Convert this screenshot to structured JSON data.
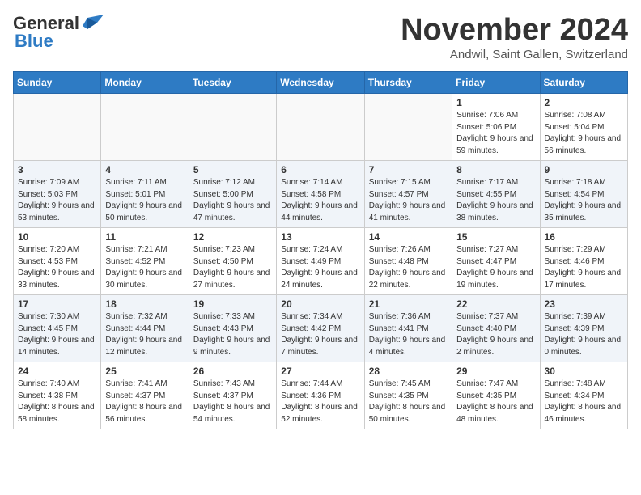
{
  "header": {
    "logo_general": "General",
    "logo_blue": "Blue",
    "month_year": "November 2024",
    "location": "Andwil, Saint Gallen, Switzerland"
  },
  "days_of_week": [
    "Sunday",
    "Monday",
    "Tuesday",
    "Wednesday",
    "Thursday",
    "Friday",
    "Saturday"
  ],
  "weeks": [
    [
      {
        "day": "",
        "info": ""
      },
      {
        "day": "",
        "info": ""
      },
      {
        "day": "",
        "info": ""
      },
      {
        "day": "",
        "info": ""
      },
      {
        "day": "",
        "info": ""
      },
      {
        "day": "1",
        "info": "Sunrise: 7:06 AM\nSunset: 5:06 PM\nDaylight: 9 hours and 59 minutes."
      },
      {
        "day": "2",
        "info": "Sunrise: 7:08 AM\nSunset: 5:04 PM\nDaylight: 9 hours and 56 minutes."
      }
    ],
    [
      {
        "day": "3",
        "info": "Sunrise: 7:09 AM\nSunset: 5:03 PM\nDaylight: 9 hours and 53 minutes."
      },
      {
        "day": "4",
        "info": "Sunrise: 7:11 AM\nSunset: 5:01 PM\nDaylight: 9 hours and 50 minutes."
      },
      {
        "day": "5",
        "info": "Sunrise: 7:12 AM\nSunset: 5:00 PM\nDaylight: 9 hours and 47 minutes."
      },
      {
        "day": "6",
        "info": "Sunrise: 7:14 AM\nSunset: 4:58 PM\nDaylight: 9 hours and 44 minutes."
      },
      {
        "day": "7",
        "info": "Sunrise: 7:15 AM\nSunset: 4:57 PM\nDaylight: 9 hours and 41 minutes."
      },
      {
        "day": "8",
        "info": "Sunrise: 7:17 AM\nSunset: 4:55 PM\nDaylight: 9 hours and 38 minutes."
      },
      {
        "day": "9",
        "info": "Sunrise: 7:18 AM\nSunset: 4:54 PM\nDaylight: 9 hours and 35 minutes."
      }
    ],
    [
      {
        "day": "10",
        "info": "Sunrise: 7:20 AM\nSunset: 4:53 PM\nDaylight: 9 hours and 33 minutes."
      },
      {
        "day": "11",
        "info": "Sunrise: 7:21 AM\nSunset: 4:52 PM\nDaylight: 9 hours and 30 minutes."
      },
      {
        "day": "12",
        "info": "Sunrise: 7:23 AM\nSunset: 4:50 PM\nDaylight: 9 hours and 27 minutes."
      },
      {
        "day": "13",
        "info": "Sunrise: 7:24 AM\nSunset: 4:49 PM\nDaylight: 9 hours and 24 minutes."
      },
      {
        "day": "14",
        "info": "Sunrise: 7:26 AM\nSunset: 4:48 PM\nDaylight: 9 hours and 22 minutes."
      },
      {
        "day": "15",
        "info": "Sunrise: 7:27 AM\nSunset: 4:47 PM\nDaylight: 9 hours and 19 minutes."
      },
      {
        "day": "16",
        "info": "Sunrise: 7:29 AM\nSunset: 4:46 PM\nDaylight: 9 hours and 17 minutes."
      }
    ],
    [
      {
        "day": "17",
        "info": "Sunrise: 7:30 AM\nSunset: 4:45 PM\nDaylight: 9 hours and 14 minutes."
      },
      {
        "day": "18",
        "info": "Sunrise: 7:32 AM\nSunset: 4:44 PM\nDaylight: 9 hours and 12 minutes."
      },
      {
        "day": "19",
        "info": "Sunrise: 7:33 AM\nSunset: 4:43 PM\nDaylight: 9 hours and 9 minutes."
      },
      {
        "day": "20",
        "info": "Sunrise: 7:34 AM\nSunset: 4:42 PM\nDaylight: 9 hours and 7 minutes."
      },
      {
        "day": "21",
        "info": "Sunrise: 7:36 AM\nSunset: 4:41 PM\nDaylight: 9 hours and 4 minutes."
      },
      {
        "day": "22",
        "info": "Sunrise: 7:37 AM\nSunset: 4:40 PM\nDaylight: 9 hours and 2 minutes."
      },
      {
        "day": "23",
        "info": "Sunrise: 7:39 AM\nSunset: 4:39 PM\nDaylight: 9 hours and 0 minutes."
      }
    ],
    [
      {
        "day": "24",
        "info": "Sunrise: 7:40 AM\nSunset: 4:38 PM\nDaylight: 8 hours and 58 minutes."
      },
      {
        "day": "25",
        "info": "Sunrise: 7:41 AM\nSunset: 4:37 PM\nDaylight: 8 hours and 56 minutes."
      },
      {
        "day": "26",
        "info": "Sunrise: 7:43 AM\nSunset: 4:37 PM\nDaylight: 8 hours and 54 minutes."
      },
      {
        "day": "27",
        "info": "Sunrise: 7:44 AM\nSunset: 4:36 PM\nDaylight: 8 hours and 52 minutes."
      },
      {
        "day": "28",
        "info": "Sunrise: 7:45 AM\nSunset: 4:35 PM\nDaylight: 8 hours and 50 minutes."
      },
      {
        "day": "29",
        "info": "Sunrise: 7:47 AM\nSunset: 4:35 PM\nDaylight: 8 hours and 48 minutes."
      },
      {
        "day": "30",
        "info": "Sunrise: 7:48 AM\nSunset: 4:34 PM\nDaylight: 8 hours and 46 minutes."
      }
    ]
  ]
}
